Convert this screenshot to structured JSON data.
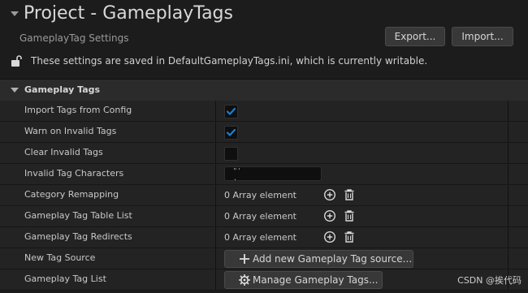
{
  "header": {
    "title": "Project - GameplayTags",
    "subtitle": "GameplayTag Settings",
    "export_label": "Export...",
    "import_label": "Import...",
    "notice": "These settings are saved in DefaultGameplayTags.ini, which is currently writable."
  },
  "section": {
    "title": "Gameplay Tags"
  },
  "rows": [
    {
      "label": "Import Tags from Config",
      "type": "checkbox",
      "checked": true
    },
    {
      "label": "Warn on Invalid Tags",
      "type": "checkbox",
      "checked": true
    },
    {
      "label": "Clear Invalid Tags",
      "type": "checkbox",
      "checked": false
    },
    {
      "label": "Invalid Tag Characters",
      "type": "text",
      "value_line1": "\"'",
      "value_line2": ","
    },
    {
      "label": "Category Remapping",
      "type": "array",
      "value": "0 Array element"
    },
    {
      "label": "Gameplay Tag Table List",
      "type": "array",
      "value": "0 Array element"
    },
    {
      "label": "Gameplay Tag Redirects",
      "type": "array",
      "value": "0 Array element"
    },
    {
      "label": "New Tag Source",
      "type": "button",
      "value": "Add new Gameplay Tag source..."
    },
    {
      "label": "Gameplay Tag List",
      "type": "button",
      "value": "Manage Gameplay Tags..."
    }
  ],
  "icons": {
    "lock": "unlocked-padlock-icon",
    "add": "plus-circle-icon",
    "delete": "trash-icon",
    "add_source": "plus-icon",
    "manage": "gear-icon"
  },
  "colors": {
    "checkbox_accent": "#1a7fd8",
    "background": "#1c1c1c",
    "row": "#232323"
  },
  "watermark": "CSDN @挨代码"
}
